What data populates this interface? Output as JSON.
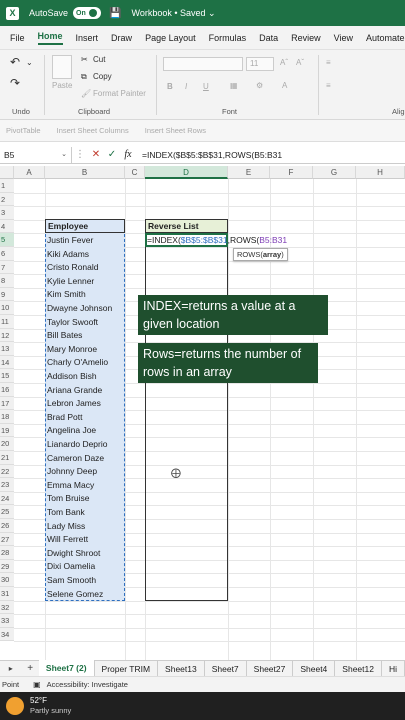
{
  "titlebar": {
    "logo": "X",
    "autosave_label": "AutoSave",
    "toggle_state": "On",
    "workbook": "Workbook • Saved ⌄"
  },
  "menu": [
    "File",
    "Home",
    "Insert",
    "Draw",
    "Page Layout",
    "Formulas",
    "Data",
    "Review",
    "View",
    "Automate"
  ],
  "ribbon": {
    "paste": "Paste",
    "cut": "Cut",
    "copy": "Copy",
    "format_painter": "Format Painter",
    "undo_group": "Undo",
    "clipboard_group": "Clipboard",
    "font_group": "Font",
    "align_group": "Alig",
    "font_size": "11",
    "bold": "B",
    "italic": "I",
    "underline": "U"
  },
  "quickbar": [
    "PivotTable",
    "Insert Sheet Columns",
    "Insert Sheet Rows"
  ],
  "formula_bar": {
    "name_box": "B5",
    "formula": "=INDEX($B$5:$B$31,ROWS(B5:B31"
  },
  "columns": [
    "A",
    "B",
    "C",
    "D",
    "E",
    "F",
    "G",
    "H"
  ],
  "rows": [
    "1",
    "2",
    "3",
    "4",
    "5",
    "6",
    "7",
    "8",
    "9",
    "10",
    "11",
    "12",
    "13",
    "14",
    "15",
    "16",
    "17",
    "18",
    "19",
    "20",
    "21",
    "22",
    "23",
    "24",
    "25",
    "26",
    "27",
    "28",
    "29",
    "30",
    "31",
    "32",
    "33",
    "34"
  ],
  "sheet": {
    "employee_header": "Employee",
    "employees": [
      "Justin Fever",
      "Kiki Adams",
      "Cristo Ronald",
      "Kylie Lenner",
      "Kim Smith",
      "Dwayne Johnson",
      "Taylor Swooft",
      "Bill Bates",
      "Mary Monroe",
      "Charly O'Amelio",
      "Addison Bish",
      "Ariana Grande",
      "Lebron James",
      "Brad Pott",
      "Angelina Joe",
      "Lianardo Deprio",
      "Cameron Daze",
      "Johnny Deep",
      "Emma Macy",
      "Tom Bruise",
      "Tom Bank",
      "Lady Miss",
      "Will Ferrett",
      "Dwight Shroot",
      "Dixi Oamelia",
      "Sam Smooth",
      "Selene Gomez"
    ],
    "reverse_header": "Reverse List",
    "cell_formula": {
      "start": "=INDEX(",
      "ref1": "$B$5:$B$31",
      "mid": ",ROWS(",
      "ref2": "B5:B31"
    },
    "tooltip": {
      "fn": "ROWS(",
      "arg": "array",
      "end": ")"
    }
  },
  "callouts": {
    "index": [
      "INDEX=returns a value at a",
      "given location"
    ],
    "rows": [
      "Rows=returns the number of",
      "rows in an array"
    ]
  },
  "tabs": [
    "Sheet7 (2)",
    "Proper TRIM",
    "Sheet13",
    "Sheet7",
    "Sheet27",
    "Sheet4",
    "Sheet12",
    "Hi"
  ],
  "statusbar": {
    "mode": "Point",
    "accessibility": "Accessibility: Investigate"
  },
  "taskbar": {
    "temp": "52°F",
    "condition": "Partly sunny"
  },
  "colors": {
    "excel_green": "#1e7145",
    "callout_bg": "#1f4f2e",
    "selection_blue": "#dbe7f6"
  }
}
